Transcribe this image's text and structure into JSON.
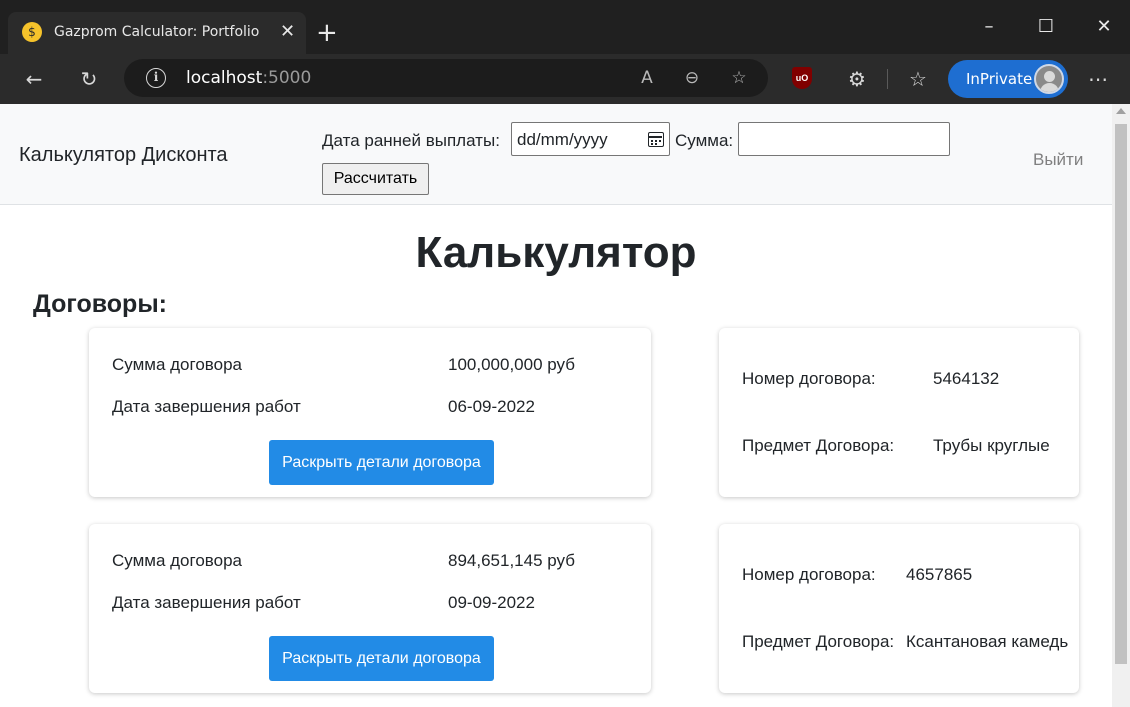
{
  "browser": {
    "tab": {
      "title": "Gazprom Calculator: Portfolio",
      "favicon": "money-mouth-emoji"
    },
    "address": {
      "host": "localhost",
      "port": ":5000"
    },
    "inprivate_label": "InPrivate"
  },
  "navbar": {
    "brand": "Калькулятор Дисконта",
    "date_label": "Дата ранней выплаты:",
    "date_placeholder": "dd/mm/yyyy",
    "sum_label": "Сумма:",
    "sum_value": "",
    "calculate_label": "Рассчитать",
    "logout_label": "Выйти"
  },
  "main": {
    "title": "Калькулятор",
    "section_title": "Договоры:",
    "contracts": [
      {
        "amount_label": "Сумма договора",
        "amount_value": "100,000,000 руб",
        "end_label": "Дата завершения работ",
        "end_value": "06-09-2022",
        "details_button": "Раскрыть детали договора",
        "number_label": "Номер договора:",
        "number_value": "5464132",
        "subject_label": "Предмет Договора:",
        "subject_value": "Трубы круглые"
      },
      {
        "amount_label": "Сумма договора",
        "amount_value": "894,651,145 руб",
        "end_label": "Дата завершения работ",
        "end_value": "09-09-2022",
        "details_button": "Раскрыть детали договора",
        "number_label": "Номер договора:",
        "number_value": "4657865",
        "subject_label": "Предмет Договора:",
        "subject_value": "Ксантановая камедь"
      }
    ]
  },
  "colors": {
    "accent_button": "#228be6",
    "navbar_bg": "#f8f9fa",
    "inprivate_badge": "#1e6ed1"
  }
}
